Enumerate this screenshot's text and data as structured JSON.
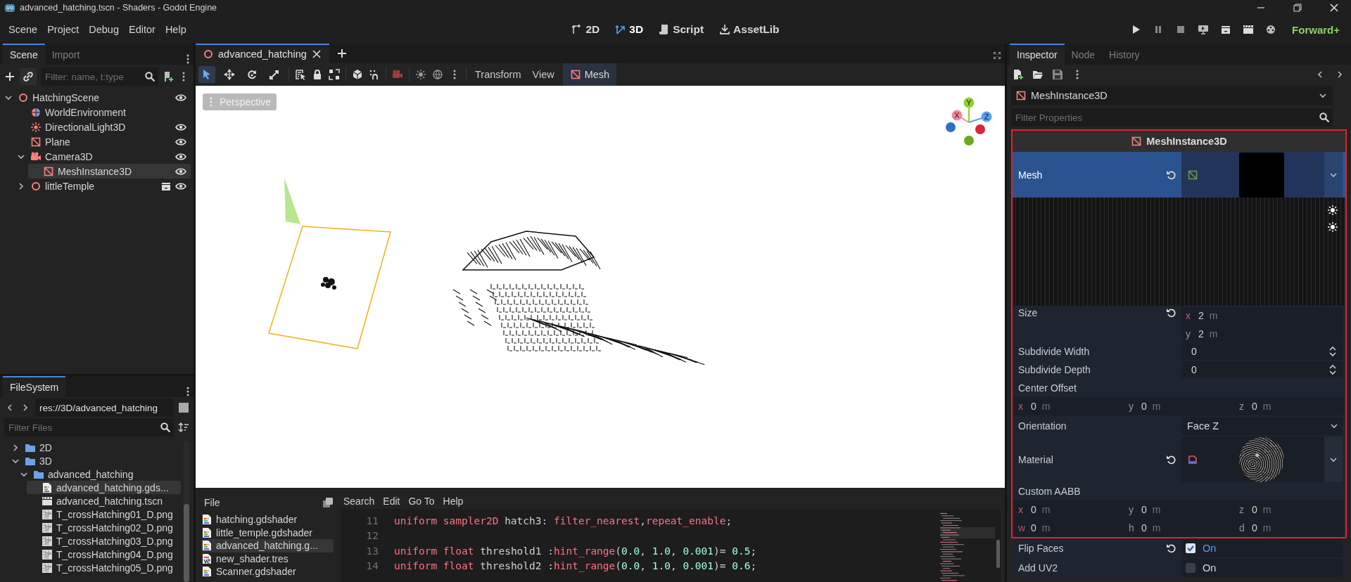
{
  "window": {
    "title": "advanced_hatching.tscn - Shaders - Godot Engine"
  },
  "menu": [
    "Scene",
    "Project",
    "Debug",
    "Editor",
    "Help"
  ],
  "workspaces": [
    {
      "label": "2D",
      "kind": "planar",
      "selected": false
    },
    {
      "label": "3D",
      "kind": "spatial",
      "selected": true
    },
    {
      "label": "Script",
      "kind": "script",
      "selected": false
    },
    {
      "label": "AssetLib",
      "kind": "assetlib",
      "selected": false
    }
  ],
  "renderer": "Forward+",
  "scene_dock": {
    "tabs": [
      {
        "label": "Scene",
        "selected": true
      },
      {
        "label": "Import",
        "selected": false
      }
    ],
    "filter": {
      "placeholder": "Filter: name, t:type"
    },
    "tree": [
      {
        "name": "HatchingScene",
        "kind": "node3d",
        "expanded": true,
        "selected": false,
        "eye_icon": true,
        "instance": false,
        "children": [
          {
            "name": "WorldEnvironment",
            "kind": "environment",
            "selected": false,
            "eye_icon": false,
            "instance": false
          },
          {
            "name": "DirectionalLight3D",
            "kind": "light",
            "selected": false,
            "eye_icon": true,
            "instance": false
          },
          {
            "name": "Plane",
            "kind": "mesh",
            "selected": false,
            "eye_icon": true,
            "instance": false
          },
          {
            "name": "Camera3D",
            "kind": "camera",
            "expanded": true,
            "selected": false,
            "eye_icon": true,
            "instance": false,
            "children": [
              {
                "name": "MeshInstance3D",
                "kind": "mesh",
                "selected": true,
                "eye_icon": true,
                "instance": false
              }
            ]
          },
          {
            "name": "littleTemple",
            "kind": "node3d",
            "expanded": false,
            "selected": false,
            "eye_icon": true,
            "instance": true
          }
        ]
      }
    ]
  },
  "filesystem": {
    "tab": "FileSystem",
    "path": "res://3D/advanced_hatching",
    "filter": {
      "placeholder": "Filter Files"
    },
    "tree": [
      {
        "name": "2D",
        "kind": "folder",
        "expanded": false,
        "selected": false
      },
      {
        "name": "3D",
        "kind": "folder",
        "expanded": true,
        "selected": false,
        "children": [
          {
            "name": "advanced_hatching",
            "kind": "folder",
            "expanded": true,
            "selected": false,
            "children": [
              {
                "name": "advanced_hatching.gds...",
                "kind": "shader",
                "selected": true
              },
              {
                "name": "advanced_hatching.tscn",
                "kind": "scene",
                "selected": false
              },
              {
                "name": "T_crossHatching01_D.png",
                "kind": "image",
                "selected": false
              },
              {
                "name": "T_crossHatching02_D.png",
                "kind": "image",
                "selected": false
              },
              {
                "name": "T_crossHatching03_D.png",
                "kind": "image",
                "selected": false
              },
              {
                "name": "T_crossHatching04_D.png",
                "kind": "image",
                "selected": false
              },
              {
                "name": "T_crossHatching05_D.png",
                "kind": "image",
                "selected": false
              }
            ]
          }
        ]
      }
    ]
  },
  "editor": {
    "scene_tabs": [
      {
        "label": "advanced_hatching",
        "selected": true
      }
    ],
    "tools": [
      {
        "kind": "select",
        "selected": true
      },
      {
        "kind": "move",
        "selected": false
      },
      {
        "kind": "rotate",
        "selected": false
      },
      {
        "kind": "scale",
        "selected": false
      }
    ],
    "menus": [
      "Transform",
      "View"
    ],
    "mesh_menu": "Mesh",
    "viewport": {
      "perspective": "Perspective",
      "gizmo_axes": [
        {
          "label": "Y",
          "kind": "y",
          "color": "#8ed12f"
        },
        {
          "label": "X",
          "kind": "x",
          "color": "#f5879b"
        },
        {
          "label": "Z",
          "kind": "z",
          "color": "#5b9ef5"
        }
      ]
    }
  },
  "script_editor": {
    "file_menu": "File",
    "menus": [
      "Search",
      "Edit",
      "Go To",
      "Help"
    ],
    "files": [
      {
        "name": "hatching.gdshader",
        "kind": "shader",
        "selected": false
      },
      {
        "name": "little_temple.gdshader",
        "kind": "shader",
        "selected": false
      },
      {
        "name": "advanced_hatching.g...",
        "kind": "shader",
        "selected": true
      },
      {
        "name": "new_shader.tres",
        "kind": "visual",
        "selected": false
      },
      {
        "name": "Scanner.gdshader",
        "kind": "shader",
        "selected": false
      }
    ],
    "lines": [
      {
        "number": "11",
        "tokens": [
          {
            "text": "uniform sampler2D",
            "kind": "keyword"
          },
          {
            "text": " hatch3: ",
            "kind": "plain"
          },
          {
            "text": "filter_nearest",
            "kind": "keyword"
          },
          {
            "text": ",",
            "kind": "plain"
          },
          {
            "text": "repeat_enable",
            "kind": "keyword"
          },
          {
            "text": ";",
            "kind": "plain"
          }
        ]
      },
      {
        "number": "12"
      },
      {
        "number": "13",
        "tokens": [
          {
            "text": "uniform float",
            "kind": "keyword"
          },
          {
            "text": " threshold1 :",
            "kind": "plain"
          },
          {
            "text": "hint_range",
            "kind": "keyword"
          },
          {
            "text": "(",
            "kind": "plain"
          },
          {
            "text": "0.0",
            "kind": "number"
          },
          {
            "text": ", ",
            "kind": "plain"
          },
          {
            "text": "1.0",
            "kind": "number"
          },
          {
            "text": ", ",
            "kind": "plain"
          },
          {
            "text": "0.001",
            "kind": "number"
          },
          {
            "text": ")= ",
            "kind": "plain"
          },
          {
            "text": "0.5",
            "kind": "number"
          },
          {
            "text": ";",
            "kind": "plain"
          }
        ]
      },
      {
        "number": "14",
        "tokens": [
          {
            "text": "uniform float",
            "kind": "keyword"
          },
          {
            "text": " threshold2 :",
            "kind": "plain"
          },
          {
            "text": "hint_range",
            "kind": "keyword"
          },
          {
            "text": "(",
            "kind": "plain"
          },
          {
            "text": "0.0",
            "kind": "number"
          },
          {
            "text": ", ",
            "kind": "plain"
          },
          {
            "text": "1.0",
            "kind": "number"
          },
          {
            "text": ", ",
            "kind": "plain"
          },
          {
            "text": "0.001",
            "kind": "number"
          },
          {
            "text": ")= ",
            "kind": "plain"
          },
          {
            "text": "0.6",
            "kind": "number"
          },
          {
            "text": ";",
            "kind": "plain"
          }
        ]
      }
    ]
  },
  "inspector": {
    "tabs": [
      {
        "label": "Inspector",
        "selected": true
      },
      {
        "label": "Node",
        "selected": false
      },
      {
        "label": "History",
        "selected": false
      }
    ],
    "object": "MeshInstance3D",
    "filter": {
      "placeholder": "Filter Properties"
    },
    "section": "MeshInstance3D",
    "properties": [
      {
        "kind": "mesh",
        "label": "Mesh",
        "revertable": true,
        "expanded": true
      },
      {
        "kind": "vector2",
        "label": "Size",
        "revertable": true,
        "components": [
          {
            "axis": "x",
            "value": "2",
            "unit": "m"
          },
          {
            "axis": "y",
            "value": "2",
            "unit": "m"
          }
        ]
      },
      {
        "kind": "spin",
        "label": "Subdivide Width",
        "value": "0",
        "revertable": false
      },
      {
        "kind": "spin",
        "label": "Subdivide Depth",
        "value": "0",
        "revertable": false
      },
      {
        "kind": "vector3",
        "label": "Center Offset",
        "revertable": false,
        "components": [
          {
            "axis": "x",
            "value": "0",
            "unit": "m"
          },
          {
            "axis": "y",
            "value": "0",
            "unit": "m"
          },
          {
            "axis": "z",
            "value": "0",
            "unit": "m"
          }
        ]
      },
      {
        "kind": "enum",
        "label": "Orientation",
        "value": "Face Z",
        "revertable": false
      },
      {
        "kind": "material",
        "label": "Material",
        "revertable": true,
        "expanded": false
      },
      {
        "kind": "vector3",
        "label": "Custom AABB",
        "revertable": false,
        "components": [
          {
            "axis": "x",
            "value": "0",
            "unit": "m"
          },
          {
            "axis": "y",
            "value": "0",
            "unit": "m"
          },
          {
            "axis": "z",
            "value": "0",
            "unit": "m"
          },
          {
            "axis": "w",
            "value": "0",
            "unit": "m"
          },
          {
            "axis": "h",
            "value": "0",
            "unit": "m"
          },
          {
            "axis": "d",
            "value": "0",
            "unit": "m"
          }
        ]
      }
    ],
    "properties_below": [
      {
        "kind": "check",
        "label": "Flip Faces",
        "revertable": true,
        "checked": true,
        "text": "On"
      },
      {
        "kind": "check",
        "label": "Add UV2",
        "revertable": false,
        "checked": false,
        "text": "On"
      }
    ]
  }
}
